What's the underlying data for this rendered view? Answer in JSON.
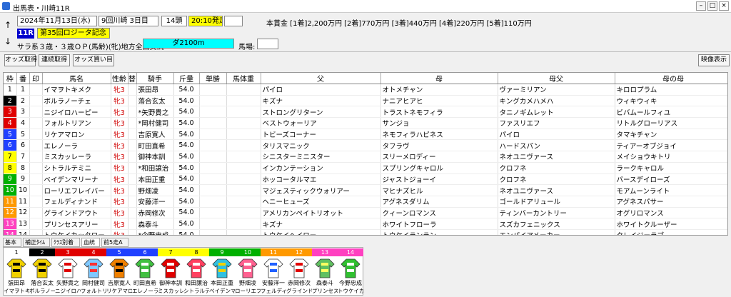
{
  "window": {
    "title": "出馬表・川崎11R"
  },
  "header": {
    "date": "2024年11月13日(水)",
    "meeting": "9回川崎 3日目",
    "runners": "14頭",
    "post_time": "20:10発走",
    "prize": "本賞金 [1着]2,200万円 [2着]770万円 [3着]440万円 [4着]220万円 [5着]110万円",
    "race_number": "11R",
    "race_name": "第35回ロジータ記念",
    "conditions": "サラ系３歳・３歳ＯＰ(馬齢)(牝)地方全国交流",
    "distance": "ダ2100m",
    "track_label": "馬場:",
    "track_value": ""
  },
  "toolbar": {
    "odds_get": "オッズ取得",
    "renpuku_get": "連続取得",
    "odds_buy": "オッズ買い目",
    "video": "映像表示"
  },
  "table": {
    "headers": [
      "枠",
      "番",
      "印",
      "馬名",
      "性齢",
      "替",
      "騎手",
      "斤量",
      "単勝",
      "馬体重",
      "父",
      "母",
      "母父",
      "母の母"
    ],
    "rows": [
      {
        "waku": "1",
        "ban": "1",
        "name": "イマヲトキメク",
        "sex": "牝3",
        "kae": "",
        "jockey": "張田昂",
        "kin": "54.0",
        "sire": "パイロ",
        "dam": "オトメチャン",
        "bms": "ヴァーミリアン",
        "dd": "キロロプラム"
      },
      {
        "waku": "2",
        "ban": "2",
        "name": "ボルラノーチェ",
        "sex": "牝3",
        "kae": "",
        "jockey": "落合玄太",
        "kin": "54.0",
        "sire": "キズナ",
        "dam": "ナニアヒアヒ",
        "bms": "キングカメハメハ",
        "dd": "ウィキウィキ"
      },
      {
        "waku": "3",
        "ban": "3",
        "name": "ニジイロハーピー",
        "sex": "牝3",
        "kae": "",
        "jockey": "*矢野貴之",
        "kin": "54.0",
        "sire": "ストロングリターン",
        "dam": "トラストネモフィラ",
        "bms": "タニノギムレット",
        "dd": "ビバムールフィユ"
      },
      {
        "waku": "4",
        "ban": "4",
        "name": "フォルトリアン",
        "sex": "牝3",
        "kae": "",
        "jockey": "*岡村健司",
        "kin": "54.0",
        "sire": "ベストウォーリア",
        "dam": "サンジョ",
        "bms": "ファスリエフ",
        "dd": "リトルグローリアス"
      },
      {
        "waku": "5",
        "ban": "5",
        "name": "リケアマロン",
        "sex": "牝3",
        "kae": "",
        "jockey": "吉原寛人",
        "kin": "54.0",
        "sire": "トビーズコーナー",
        "dam": "ネモフィラハピネス",
        "bms": "パイロ",
        "dd": "タマキチャン"
      },
      {
        "waku": "6",
        "ban": "6",
        "name": "エレノーラ",
        "sex": "牝3",
        "kae": "",
        "jockey": "町田直希",
        "kin": "54.0",
        "sire": "タリスマニック",
        "dam": "タフラヴ",
        "bms": "ハードスパン",
        "dd": "ティアーオブジョイ"
      },
      {
        "waku": "7",
        "ban": "7",
        "name": "ミスカッレーラ",
        "sex": "牝3",
        "kae": "",
        "jockey": "御神本訓",
        "kin": "54.0",
        "sire": "シニスターミニスター",
        "dam": "スリーメロディー",
        "bms": "ネオユニヴァース",
        "dd": "メイショウキトリ"
      },
      {
        "waku": "8",
        "ban": "8",
        "name": "シトラルテミニ",
        "sex": "牝3",
        "kae": "",
        "jockey": "*和田譲治",
        "kin": "54.0",
        "sire": "インカンテーション",
        "dam": "スプリングキャロル",
        "bms": "クロフネ",
        "dd": "ラークキャロル"
      },
      {
        "waku": "9",
        "ban": "9",
        "name": "ベイデンマリーナ",
        "sex": "牝3",
        "kae": "",
        "jockey": "本田正重",
        "kin": "54.0",
        "sire": "ホッコータルマエ",
        "dam": "ジャストジョーイ",
        "bms": "クロフネ",
        "dd": "バースデイローズ"
      },
      {
        "waku": "10",
        "ban": "10",
        "name": "ローリエフレイバー",
        "sex": "牝3",
        "kae": "",
        "jockey": "野畑凌",
        "kin": "54.0",
        "sire": "マジェスティックウォリアー",
        "dam": "マヒナズヒル",
        "bms": "ネオユニヴァース",
        "dd": "モアムーンライト"
      },
      {
        "waku": "11",
        "ban": "11",
        "name": "フェルディナンド",
        "sex": "牝3",
        "kae": "",
        "jockey": "安藤洋一",
        "kin": "54.0",
        "sire": "ヘニーヒューズ",
        "dam": "アグネスダリム",
        "bms": "ゴールドアリュール",
        "dd": "アグネスパサー"
      },
      {
        "waku": "12",
        "ban": "12",
        "name": "グラインドアウト",
        "sex": "牝3",
        "kae": "",
        "jockey": "赤岡修次",
        "kin": "54.0",
        "sire": "アメリカンペイトリオット",
        "dam": "クィーンロマンス",
        "bms": "ティンバーカントリー",
        "dd": "オグリロマンス"
      },
      {
        "waku": "13",
        "ban": "13",
        "name": "プリンセスアリー",
        "sex": "牝3",
        "kae": "",
        "jockey": "森泰斗",
        "kin": "54.0",
        "sire": "キズナ",
        "dam": "ホワイトフローラ",
        "bms": "スズカフェニックス",
        "dd": "ホワイトクルーザー"
      },
      {
        "waku": "14",
        "ban": "14",
        "name": "トウケイカッタロー",
        "sex": "牝3",
        "kae": "",
        "jockey": "*今野忠成",
        "kin": "54.0",
        "sire": "トウケイヘイロー",
        "dam": "トウケイランラン",
        "bms": "エンパイアメーカー",
        "dd": "クレイジーラブ"
      }
    ]
  },
  "tabs": [
    "基本",
    "補正ﾀｲﾑ",
    "ｸﾗｽ別着",
    "血統",
    "前5走A"
  ],
  "silks": [
    {
      "num": "1",
      "jockey": "張田昂",
      "horse": "イマヲトキ",
      "color": "#ffffff",
      "num_color": "#000000",
      "body": "#f0d000",
      "accent": "#000000"
    },
    {
      "num": "2",
      "jockey": "落合玄太",
      "horse": "ボルラノー",
      "color": "#000000",
      "num_color": "#ffffff",
      "body": "#f0d000",
      "accent": "#000000"
    },
    {
      "num": "3",
      "jockey": "矢野貴之",
      "horse": "ニジイロハ",
      "color": "#e00000",
      "num_color": "#ffffff",
      "body": "#ffffff",
      "accent": "#e00000"
    },
    {
      "num": "4",
      "jockey": "岡村健司",
      "horse": "フォルトリ",
      "color": "#e00000",
      "num_color": "#ffffff",
      "body": "#80c8ff",
      "accent": "#ff3030"
    },
    {
      "num": "5",
      "jockey": "吉原寛人",
      "horse": "リケアマロ",
      "color": "#2040ff",
      "num_color": "#ffffff",
      "body": "#f08000",
      "accent": "#000000"
    },
    {
      "num": "6",
      "jockey": "町田直希",
      "horse": "エレノーラ",
      "color": "#2040ff",
      "num_color": "#ffffff",
      "body": "#40c040",
      "accent": "#ffffff"
    },
    {
      "num": "7",
      "jockey": "御神本訓",
      "horse": "ミスカッレ",
      "color": "#ffff00",
      "num_color": "#000000",
      "body": "#e00000",
      "accent": "#ffffff"
    },
    {
      "num": "8",
      "jockey": "和田譲治",
      "horse": "シトラルテ",
      "color": "#ffff00",
      "num_color": "#000000",
      "body": "#ff4060",
      "accent": "#ffffff"
    },
    {
      "num": "9",
      "jockey": "本田正重",
      "horse": "ベイデンマ",
      "color": "#00b000",
      "num_color": "#ffffff",
      "body": "#30c0e0",
      "accent": "#f0d000"
    },
    {
      "num": "10",
      "jockey": "野畑凌",
      "horse": "ローリエフ",
      "color": "#00b000",
      "num_color": "#ffffff",
      "body": "#ff6090",
      "accent": "#ffffff"
    },
    {
      "num": "11",
      "jockey": "安藤洋一",
      "horse": "フェルディ",
      "color": "#ff9900",
      "num_color": "#ffffff",
      "body": "#ffffff",
      "accent": "#2060ff"
    },
    {
      "num": "12",
      "jockey": "赤岡修次",
      "horse": "グラインド",
      "color": "#ff9900",
      "num_color": "#ffffff",
      "body": "#ffffff",
      "accent": "#e00000"
    },
    {
      "num": "13",
      "jockey": "森泰斗",
      "horse": "プリンセス",
      "color": "#ff40c0",
      "num_color": "#ffffff",
      "body": "#60c060",
      "accent": "#ffff60"
    },
    {
      "num": "14",
      "jockey": "今野忠成",
      "horse": "トウケイカ",
      "color": "#ff40c0",
      "num_color": "#ffffff",
      "body": "#30c030",
      "accent": "#ffffff"
    }
  ],
  "waku_colors": {
    "1": {
      "bg": "#ffffff",
      "fg": "#000000"
    },
    "2": {
      "bg": "#000000",
      "fg": "#ffffff"
    },
    "3": {
      "bg": "#e00000",
      "fg": "#ffffff"
    },
    "4": {
      "bg": "#e00000",
      "fg": "#ffffff"
    },
    "5": {
      "bg": "#2040ff",
      "fg": "#ffffff"
    },
    "6": {
      "bg": "#2040ff",
      "fg": "#ffffff"
    },
    "7": {
      "bg": "#ffff00",
      "fg": "#000000"
    },
    "8": {
      "bg": "#ffff00",
      "fg": "#000000"
    },
    "9": {
      "bg": "#00b000",
      "fg": "#ffffff"
    },
    "10": {
      "bg": "#00b000",
      "fg": "#ffffff"
    },
    "11": {
      "bg": "#ff9900",
      "fg": "#ffffff"
    },
    "12": {
      "bg": "#ff9900",
      "fg": "#ffffff"
    },
    "13": {
      "bg": "#ff40c0",
      "fg": "#ffffff"
    },
    "14": {
      "bg": "#ff40c0",
      "fg": "#ffffff"
    }
  }
}
